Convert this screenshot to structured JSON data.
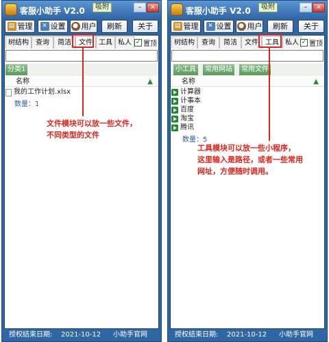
{
  "app": {
    "title": "客服小助手 V2.0",
    "pin_label": "吸附",
    "min": "–",
    "close": "×"
  },
  "toolbar": {
    "manage": "管理",
    "settings": "设置",
    "user": "用户",
    "refresh": "刷新",
    "about": "关于"
  },
  "tabs": [
    "树结构",
    "查询",
    "简洁",
    "文件",
    "工具",
    "私人"
  ],
  "top_checkbox": {
    "label": "置顶",
    "checked": true
  },
  "list_header": {
    "name": "名称",
    "sort_icon": "▲"
  },
  "count_label": "数量：",
  "windows": [
    {
      "active_tab": "文件",
      "categories": [
        "分类1"
      ],
      "items": [
        "我的工作计划.xlsx"
      ],
      "count": "1",
      "note": [
        "文件模块可以放一些文件，",
        "不同类型的文件"
      ]
    },
    {
      "active_tab": "工具",
      "categories": [
        "小工具",
        "常用网站",
        "常用文件"
      ],
      "items": [
        "计算器",
        "计事本",
        "百度",
        "淘宝",
        "腾讯"
      ],
      "count": "5",
      "note": [
        "工具模块可以放一些小程序，",
        "这里输入是路径，或者一些常用",
        "网址，方便随时调用。"
      ]
    }
  ],
  "status": {
    "label": "授权结束日期:",
    "date": "2021-10-12",
    "link": "小助手官网"
  },
  "colors": {
    "frame": "#2f66a4",
    "annotation": "#e2231a",
    "tab_green": "#5a9a5a",
    "play_green": "#1e8a2e"
  }
}
